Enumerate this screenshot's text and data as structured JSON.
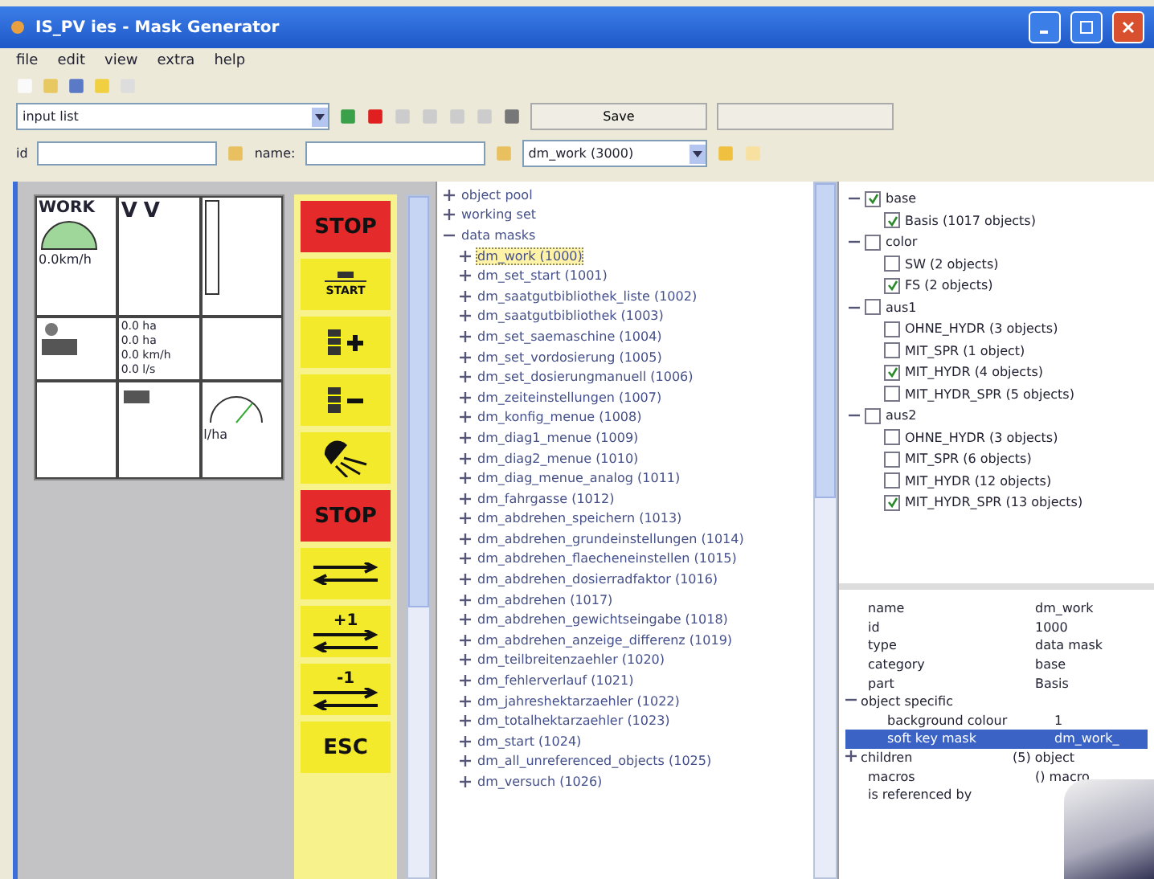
{
  "window": {
    "title": "IS_PV ies - Mask Generator"
  },
  "menu": [
    "file",
    "edit",
    "view",
    "extra",
    "help"
  ],
  "list_bar": {
    "value": "input list",
    "button": "Save"
  },
  "filter_bar": {
    "id_label": "id",
    "name_label": "name:",
    "mask_value": "dm_work (3000)"
  },
  "mask_preview": {
    "title": "WORK",
    "letters": [
      "V",
      "V"
    ],
    "speed": "0.0km/h",
    "readings": [
      "0.0 ha",
      "0.0 ha",
      "0.0 km/h",
      "0.0 l/s"
    ],
    "unit": "l/ha"
  },
  "soft_keys": [
    {
      "kind": "text",
      "label": "STOP",
      "color": "#e42a2a"
    },
    {
      "kind": "start",
      "label": "START",
      "color": "#f4ea2c"
    },
    {
      "kind": "plus",
      "color": "#f4ea2c"
    },
    {
      "kind": "minus",
      "color": "#f4ea2c"
    },
    {
      "kind": "light",
      "color": "#f4ea2c"
    },
    {
      "kind": "text",
      "label": "STOP",
      "color": "#e42a2a"
    },
    {
      "kind": "arrows",
      "color": "#f4ea2c"
    },
    {
      "kind": "arrows",
      "label": "+1",
      "color": "#f4ea2c"
    },
    {
      "kind": "arrows",
      "label": "-1",
      "color": "#f4ea2c"
    },
    {
      "kind": "text",
      "label": "ESC",
      "color": "#f4ea2c"
    }
  ],
  "object_tree": [
    {
      "label": "object pool",
      "expanded": false,
      "selected": false
    },
    {
      "label": "working set",
      "expanded": false,
      "selected": false
    },
    {
      "label": "data masks",
      "expanded": true,
      "selected": false,
      "children": [
        {
          "label": "dm_work (1000)",
          "expanded": false,
          "selected": true
        },
        {
          "label": "dm_set_start (1001)",
          "expanded": false,
          "selected": false
        },
        {
          "label": "dm_saatgutbibliothek_liste (1002)",
          "expanded": false,
          "selected": false
        },
        {
          "label": "dm_saatgutbibliothek (1003)",
          "expanded": false,
          "selected": false
        },
        {
          "label": "dm_set_saemaschine (1004)",
          "expanded": false,
          "selected": false
        },
        {
          "label": "dm_set_vordosierung (1005)",
          "expanded": false,
          "selected": false
        },
        {
          "label": "dm_set_dosierungmanuell (1006)",
          "expanded": false,
          "selected": false
        },
        {
          "label": "dm_zeiteinstellungen (1007)",
          "expanded": false,
          "selected": false
        },
        {
          "label": "dm_konfig_menue (1008)",
          "expanded": false,
          "selected": false
        },
        {
          "label": "dm_diag1_menue (1009)",
          "expanded": false,
          "selected": false
        },
        {
          "label": "dm_diag2_menue (1010)",
          "expanded": false,
          "selected": false
        },
        {
          "label": "dm_diag_menue_analog (1011)",
          "expanded": false,
          "selected": false
        },
        {
          "label": "dm_fahrgasse (1012)",
          "expanded": false,
          "selected": false
        },
        {
          "label": "dm_abdrehen_speichern (1013)",
          "expanded": false,
          "selected": false
        },
        {
          "label": "dm_abdrehen_grundeinstellungen (1014)",
          "expanded": false,
          "selected": false
        },
        {
          "label": "dm_abdrehen_flaecheneinstellen (1015)",
          "expanded": false,
          "selected": false
        },
        {
          "label": "dm_abdrehen_dosierradfaktor (1016)",
          "expanded": false,
          "selected": false
        },
        {
          "label": "dm_abdrehen (1017)",
          "expanded": false,
          "selected": false
        },
        {
          "label": "dm_abdrehen_gewichtseingabe (1018)",
          "expanded": false,
          "selected": false
        },
        {
          "label": "dm_abdrehen_anzeige_differenz (1019)",
          "expanded": false,
          "selected": false
        },
        {
          "label": "dm_teilbreitenzaehler (1020)",
          "expanded": false,
          "selected": false
        },
        {
          "label": "dm_fehlerverlauf (1021)",
          "expanded": false,
          "selected": false
        },
        {
          "label": "dm_jahreshektarzaehler (1022)",
          "expanded": false,
          "selected": false
        },
        {
          "label": "dm_totalhektarzaehler (1023)",
          "expanded": false,
          "selected": false
        },
        {
          "label": "dm_start (1024)",
          "expanded": false,
          "selected": false
        },
        {
          "label": "dm_all_unreferenced_objects (1025)",
          "expanded": false,
          "selected": false
        },
        {
          "label": "dm_versuch (1026)",
          "expanded": false,
          "selected": false
        }
      ]
    }
  ],
  "part_tree": [
    {
      "label": "base",
      "checked": true,
      "children": [
        {
          "label": "Basis (1017 objects)",
          "checked": true
        }
      ]
    },
    {
      "label": "color",
      "checked": false,
      "children": [
        {
          "label": "SW (2 objects)",
          "checked": false
        },
        {
          "label": "FS (2 objects)",
          "checked": true
        }
      ]
    },
    {
      "label": "aus1",
      "checked": false,
      "children": [
        {
          "label": "OHNE_HYDR (3 objects)",
          "checked": false
        },
        {
          "label": "MIT_SPR (1 object)",
          "checked": false
        },
        {
          "label": "MIT_HYDR (4 objects)",
          "checked": true
        },
        {
          "label": "MIT_HYDR_SPR (5 objects)",
          "checked": false
        }
      ]
    },
    {
      "label": "aus2",
      "checked": false,
      "children": [
        {
          "label": "OHNE_HYDR (3 objects)",
          "checked": false
        },
        {
          "label": "MIT_SPR (6 objects)",
          "checked": false
        },
        {
          "label": "MIT_HYDR (12 objects)",
          "checked": false
        },
        {
          "label": "MIT_HYDR_SPR (13 objects)",
          "checked": true
        }
      ]
    }
  ],
  "properties": [
    {
      "name": "name",
      "value": "dm_work",
      "selected": false
    },
    {
      "name": "id",
      "value": "1000",
      "selected": false
    },
    {
      "name": "type",
      "value": "data mask",
      "selected": false
    },
    {
      "name": "category",
      "value": "base",
      "selected": false
    },
    {
      "name": "part",
      "value": "Basis",
      "selected": false
    },
    {
      "name": "object specific",
      "group": true,
      "selected": false,
      "children": [
        {
          "name": "background colour",
          "value": "1",
          "selected": false
        },
        {
          "name": "soft key mask",
          "value": "dm_work_",
          "selected": true
        }
      ]
    },
    {
      "name": "children",
      "value": "(5) object",
      "group": true,
      "selected": false
    },
    {
      "name": "macros",
      "value": "() macro",
      "selected": false
    },
    {
      "name": "is referenced by",
      "selected": false
    }
  ]
}
